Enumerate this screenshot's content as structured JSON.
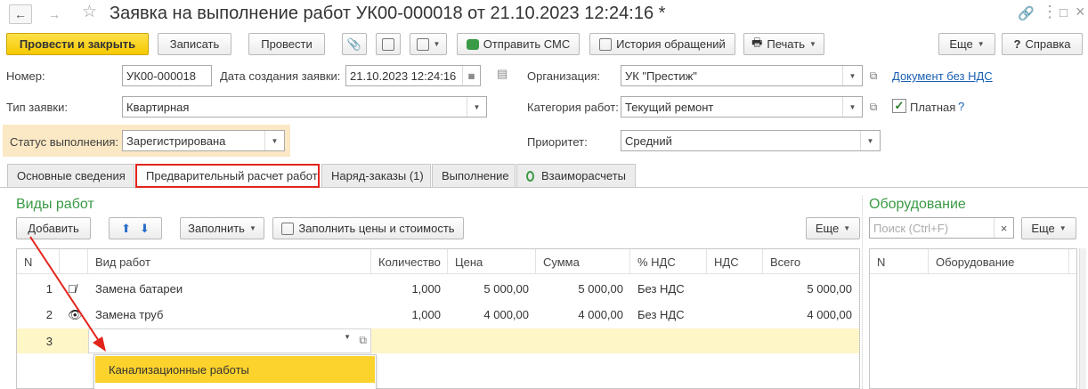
{
  "window": {
    "title": "Заявка на выполнение работ УК00-000018 от 21.10.2023 12:24:16 *",
    "back_icon": "arrow-left-icon",
    "forward_icon": "arrow-right-icon"
  },
  "toolbar": {
    "post_close": "Провести и закрыть",
    "save": "Записать",
    "post": "Провести",
    "send_sms": "Отправить СМС",
    "history": "История обращений",
    "print": "Печать",
    "more": "Еще",
    "help": "Справка",
    "help_mark": "?"
  },
  "form": {
    "number_label": "Номер:",
    "number_value": "УК00-000018",
    "date_label": "Дата создания заявки:",
    "date_value": "21.10.2023 12:24:16",
    "org_label": "Организация:",
    "org_value": "УК \"Престиж\"",
    "doc_link": "Документ без НДС",
    "type_label": "Тип заявки:",
    "type_value": "Квартирная",
    "category_label": "Категория работ:",
    "category_value": "Текущий ремонт",
    "paid_label": "Платная",
    "paid_checked": true,
    "paid_help": "?",
    "status_label": "Статус выполнения:",
    "status_value": "Зарегистрирована",
    "priority_label": "Приоритет:",
    "priority_value": "Средний"
  },
  "tabs": [
    {
      "label": "Основные сведения"
    },
    {
      "label": "Предварительный расчет работ"
    },
    {
      "label": "Наряд-заказы (1)"
    },
    {
      "label": "Выполнение"
    },
    {
      "label": "Взаиморасчеты"
    }
  ],
  "works": {
    "title": "Виды работ",
    "add": "Добавить",
    "fill": "Заполнить",
    "fill_prices": "Заполнить цены и стоимость",
    "more": "Еще",
    "columns": [
      "N",
      "Вид работ",
      "Количество",
      "Цена",
      "Сумма",
      "% НДС",
      "НДС",
      "Всего"
    ],
    "rows": [
      {
        "n": "1",
        "name": "Замена батареи",
        "qty": "1,000",
        "price": "5 000,00",
        "sum": "5 000,00",
        "vat_rate": "Без НДС",
        "vat": "",
        "total": "5 000,00"
      },
      {
        "n": "2",
        "name": "Замена труб",
        "qty": "1,000",
        "price": "4 000,00",
        "sum": "4 000,00",
        "vat_rate": "Без НДС",
        "vat": "",
        "total": "4 000,00"
      }
    ],
    "new_row_n": "3",
    "dropdown_item": "Канализационные работы"
  },
  "equipment": {
    "title": "Оборудование",
    "search_placeholder": "Поиск (Ctrl+F)",
    "more": "Еще",
    "columns": [
      "N",
      "Оборудование"
    ]
  },
  "colors": {
    "primary_button": "#f6c800",
    "section_title": "#3a9a45",
    "highlight": "#e2231a",
    "status_bg": "#fbe8c4",
    "new_row": "#fff6c8",
    "dropdown_selected": "#fcd22c"
  }
}
